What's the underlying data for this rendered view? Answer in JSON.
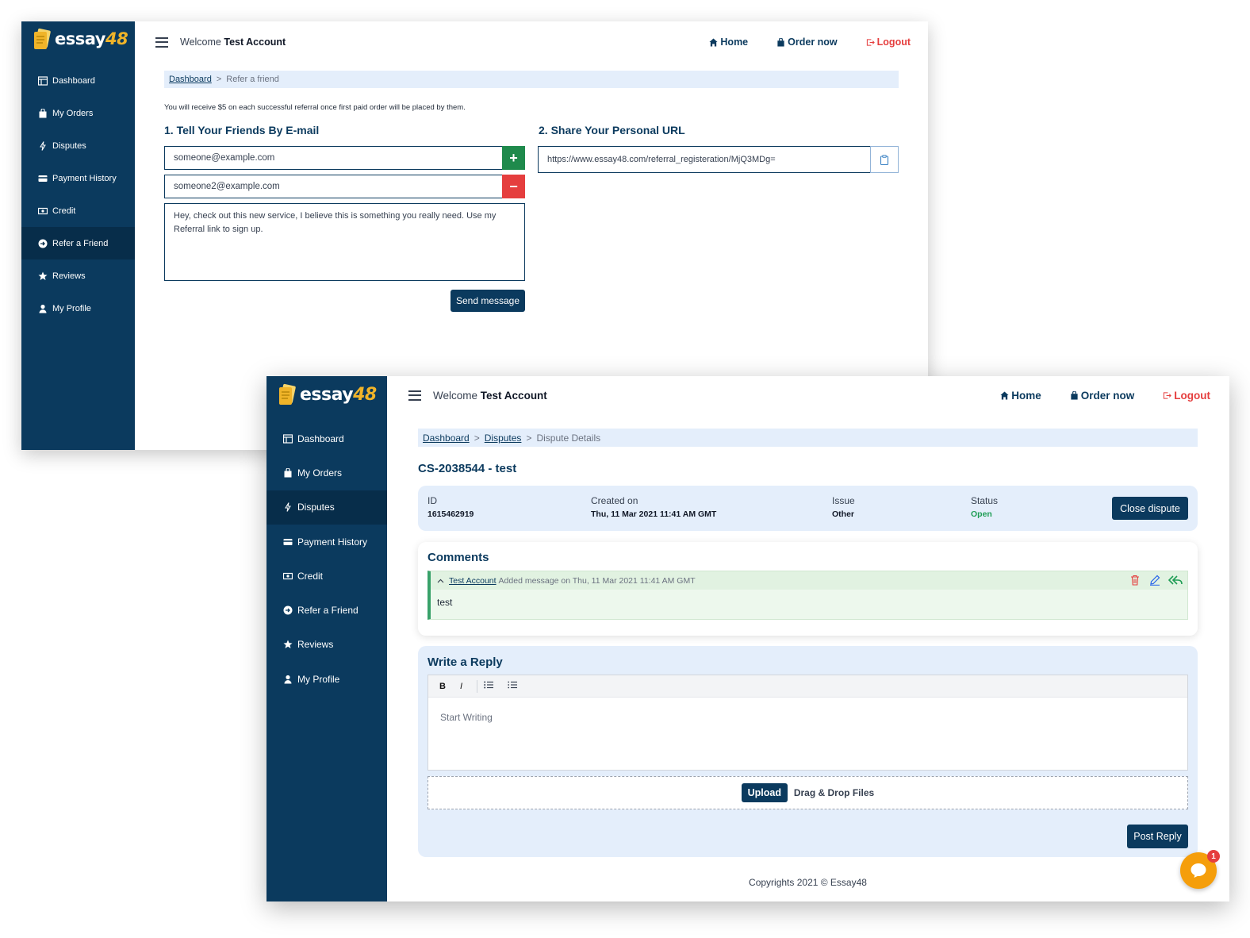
{
  "brand": {
    "name": "essay",
    "number": "48"
  },
  "colors": {
    "sidebar": "#0b3a5e",
    "accent": "#f0b429",
    "success": "#1f9d55",
    "danger": "#e53e3e",
    "light_panel": "#e4eefb"
  },
  "sidebar": {
    "items": [
      {
        "label": "Dashboard",
        "icon": "dashboard-icon"
      },
      {
        "label": "My Orders",
        "icon": "bag-icon"
      },
      {
        "label": "Disputes",
        "icon": "bolt-icon"
      },
      {
        "label": "Payment History",
        "icon": "card-icon"
      },
      {
        "label": "Credit",
        "icon": "cash-icon"
      },
      {
        "label": "Refer a Friend",
        "icon": "arrow-circle-icon"
      },
      {
        "label": "Reviews",
        "icon": "star-icon"
      },
      {
        "label": "My Profile",
        "icon": "user-icon"
      }
    ]
  },
  "topbar": {
    "welcome_prefix": "Welcome",
    "user_name": "Test Account",
    "home": "Home",
    "order_now": "Order now",
    "logout": "Logout"
  },
  "refer": {
    "breadcrumb": {
      "root": "Dashboard",
      "sep": ">",
      "current": "Refer a friend"
    },
    "notice": "You will receive $5 on each successful referral once first paid order will be placed by them.",
    "email_heading": "1. Tell Your Friends By E-mail",
    "email1": "someone@example.com",
    "email2": "someone2@example.com",
    "message": "Hey, check out this new service, I believe this is something you really need. Use my Referral link to sign up.",
    "send_label": "Send message",
    "url_heading": "2. Share Your Personal URL",
    "url": "https://www.essay48.com/referral_registeration/MjQ3MDg="
  },
  "dispute": {
    "breadcrumb": {
      "root": "Dashboard",
      "sep": ">",
      "middle": "Disputes",
      "current": "Dispute Details"
    },
    "title": "CS-2038544 - test",
    "id_label": "ID",
    "id_value": "1615462919",
    "created_label": "Created on",
    "created_value": "Thu, 11 Mar 2021 11:41 AM GMT",
    "issue_label": "Issue",
    "issue_value": "Other",
    "status_label": "Status",
    "status_value": "Open",
    "close_label": "Close dispute",
    "comments_heading": "Comments",
    "comment": {
      "author": "Test Account",
      "meta": "Added message on Thu, 11 Mar 2021 11:41 AM GMT",
      "body": "test"
    },
    "reply_heading": "Write a Reply",
    "toolbar": {
      "bold": "B",
      "italic": "I"
    },
    "editor_placeholder": "Start Writing",
    "upload_label": "Upload",
    "drag_label": "Drag & Drop Files",
    "post_label": "Post Reply",
    "footer": "Copyrights 2021 © Essay48",
    "chat_badge": "1"
  }
}
